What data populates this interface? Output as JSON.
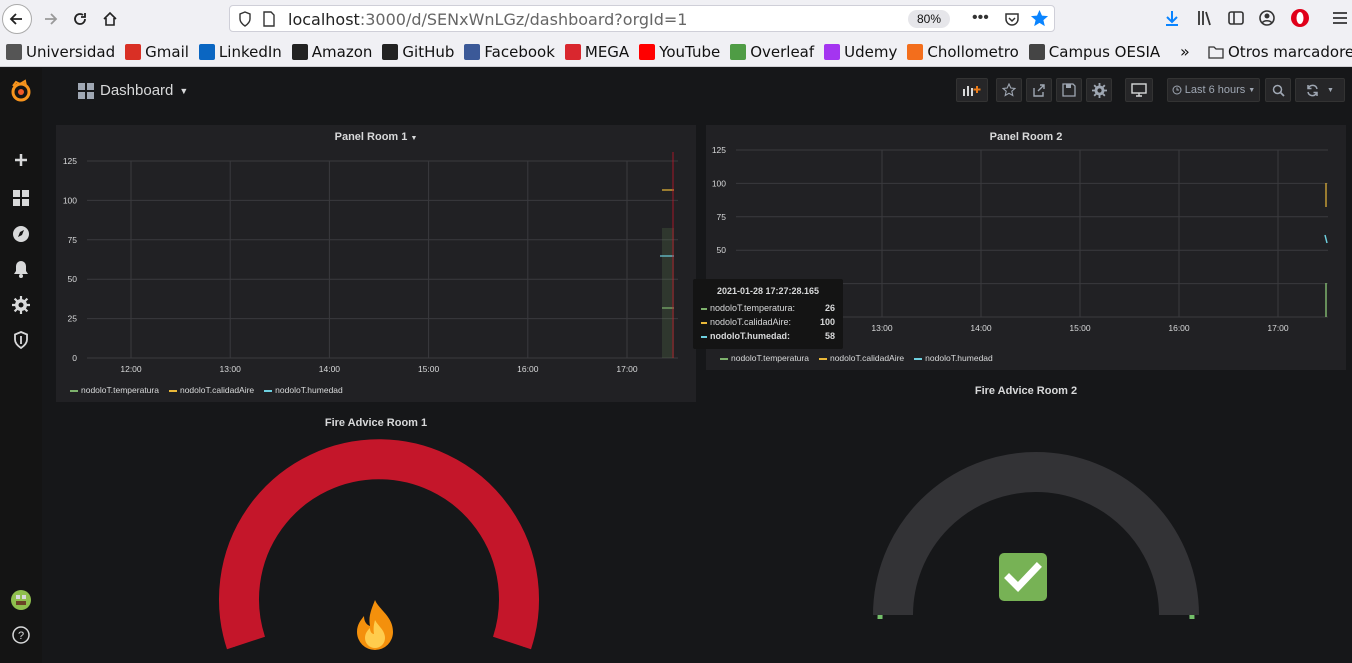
{
  "browser": {
    "url_host": "localhost",
    "url_rest": ":3000/d/SENxWnLGz/dashboard?orgId=1",
    "zoom": "80%"
  },
  "bookmarks": [
    {
      "label": "Universidad",
      "icon": "folder-icon",
      "color": "#555"
    },
    {
      "label": "Gmail",
      "icon": "gmail-icon",
      "color": "#d93025"
    },
    {
      "label": "LinkedIn",
      "icon": "linkedin-icon",
      "color": "#0a66c2"
    },
    {
      "label": "Amazon",
      "icon": "amazon-icon",
      "color": "#222"
    },
    {
      "label": "GitHub",
      "icon": "github-icon",
      "color": "#222"
    },
    {
      "label": "Facebook",
      "icon": "facebook-icon",
      "color": "#3b5998"
    },
    {
      "label": "MEGA",
      "icon": "mega-icon",
      "color": "#d9272e"
    },
    {
      "label": "YouTube",
      "icon": "youtube-icon",
      "color": "#ff0000"
    },
    {
      "label": "Overleaf",
      "icon": "overleaf-icon",
      "color": "#4f9c45"
    },
    {
      "label": "Udemy",
      "icon": "udemy-icon",
      "color": "#a435f0"
    },
    {
      "label": "Chollometro",
      "icon": "flame-icon",
      "color": "#f36e1c"
    },
    {
      "label": "Campus OESIA",
      "icon": "globe-icon",
      "color": "#444"
    }
  ],
  "bookmarks_other": "Otros marcadores",
  "dashboard": {
    "title": "Dashboard",
    "time_range": "Last 6 hours"
  },
  "panels": {
    "room1": {
      "title": "Panel Room 1",
      "y_ticks": [
        "125",
        "100",
        "75",
        "50",
        "25",
        "0"
      ],
      "x_ticks": [
        "12:00",
        "13:00",
        "14:00",
        "15:00",
        "16:00",
        "17:00"
      ],
      "legend": [
        "nodoloT.temperatura",
        "nodoloT.calidadAire",
        "nodoloT.humedad"
      ]
    },
    "room2": {
      "title": "Panel Room 2",
      "y_ticks": [
        "125",
        "100",
        "75",
        "50"
      ],
      "x_ticks": [
        "13:00",
        "14:00",
        "15:00",
        "16:00",
        "17:00"
      ],
      "legend": [
        "nodoloT.temperatura",
        "nodoloT.calidadAire",
        "nodoloT.humedad"
      ]
    },
    "fire1": {
      "title": "Fire Advice Room 1",
      "icon": "fire-icon"
    },
    "fire2": {
      "title": "Fire Advice Room 2",
      "icon": "check-icon"
    }
  },
  "tooltip": {
    "time": "2021-01-28 17:27:28.165",
    "rows": [
      {
        "name": "nodoloT.temperatura:",
        "value": "26",
        "color": "#7eb26d"
      },
      {
        "name": "nodoloT.calidadAire:",
        "value": "100",
        "color": "#eab839"
      },
      {
        "name": "nodoloT.humedad:",
        "value": "58",
        "color": "#6ed0e0"
      }
    ]
  },
  "colors": {
    "temperatura": "#7eb26d",
    "calidadAire": "#eab839",
    "humedad": "#6ed0e0",
    "gauge_red": "#c4162a",
    "gauge_green": "#73bf69"
  }
}
